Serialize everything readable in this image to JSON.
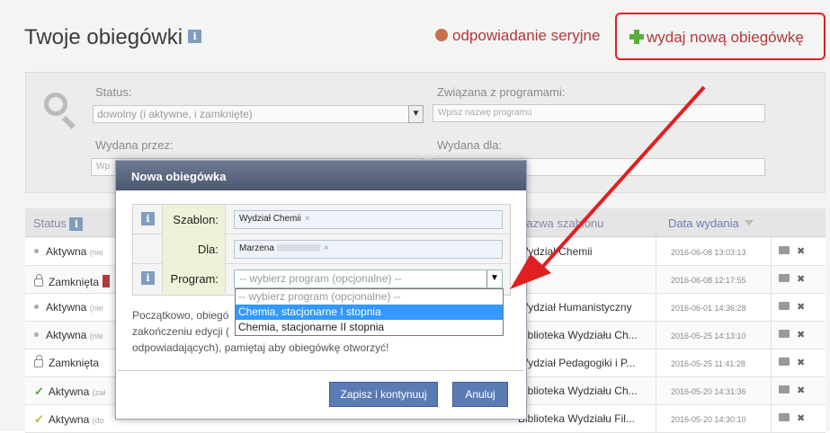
{
  "header": {
    "title": "Twoje obiegówki",
    "info": "i",
    "serial_label": "odpowiadanie seryjne",
    "new_label": "wydaj nową obiegówkę"
  },
  "filters": {
    "status_label": "Status:",
    "status_value": "dowolny (i aktywne, i zamknięte)",
    "programs_label": "Związana z programami:",
    "programs_placeholder": "Wpisz nazwę programu",
    "issued_by_label": "Wydana przez:",
    "issued_by_placeholder": "Wp",
    "issued_for_label": "Wydana dla:"
  },
  "table": {
    "col_status": "Status",
    "col_template": "Nazwa szablonu",
    "col_date": "Data wydania",
    "rows": [
      {
        "status": "Aktywna",
        "note": "(nie",
        "template": "Wydział Chemii",
        "date": "2016-06-08 13:03:13",
        "icon": "dot"
      },
      {
        "status": "Zamknięta",
        "note": "",
        "template": "ii",
        "date": "2016-06-08 12:17:55",
        "icon": "lock"
      },
      {
        "status": "Aktywna",
        "note": "(nie",
        "template": "Wydział Humanistyczny",
        "date": "2016-06-01 14:36:28",
        "icon": "dot"
      },
      {
        "status": "Aktywna",
        "note": "(nie",
        "template": "Biblioteka Wydziału Ch...",
        "date": "2016-05-25 14:13:10",
        "icon": "dot"
      },
      {
        "status": "Zamknięta",
        "note": "",
        "template": "Wydział Pedagogiki i P...",
        "date": "2016-05-25 11:41:28",
        "icon": "lock"
      },
      {
        "status": "Aktywna",
        "note": "(zał",
        "template": "Biblioteka Wydziału Ch...",
        "date": "2016-05-20 14:31:36",
        "icon": "check"
      },
      {
        "status": "Aktywna",
        "note": "(do",
        "template": "Biblioteka Wydziału Fil...",
        "date": "2016-05-20 14:30:10",
        "icon": "check-y"
      }
    ]
  },
  "modal": {
    "title": "Nowa obiegówka",
    "szablon_label": "Szablon:",
    "szablon_value": "Wydział Chemii",
    "dla_label": "Dla:",
    "dla_value": "Marzena",
    "program_label": "Program:",
    "program_value": "-- wybierz program (opcjonalne) --",
    "remove": "×",
    "text_lines": [
      "Początkowo, obiegó",
      "zakończeniu edycji (",
      "odpowiadających), pamiętaj aby obiegówkę otworzyć!"
    ],
    "save_label": "Zapisz i kontynuuj",
    "cancel_label": "Anuluj"
  },
  "dropdown": {
    "options": [
      "-- wybierz program (opcjonalne) --",
      "Chemia, stacjonarne I stopnia",
      "Chemia, stacjonarne II stopnia"
    ],
    "selected_index": 1
  },
  "colors": {
    "accent_red": "#e02020",
    "modal_header": "#5a6580",
    "button_blue": "#5b7bb5",
    "selection_blue": "#3399ff"
  }
}
